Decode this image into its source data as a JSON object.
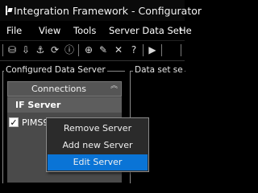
{
  "window": {
    "title": "Integration Framework - Configurator"
  },
  "menu": {
    "items": [
      "File",
      "View",
      "Tools",
      "Server Data Set",
      "He"
    ]
  },
  "toolbar": {
    "icons": [
      "save-icon",
      "import-icon",
      "connect-icon",
      "refresh-icon",
      "info-icon",
      "add-icon",
      "edit-icon",
      "delete-icon",
      "help-icon",
      "run-icon"
    ]
  },
  "left_panel": {
    "title": "Configured Data Server",
    "header": "Connections",
    "group": "IF Server",
    "server": {
      "label": "PIMS904 - Ma",
      "checked": true
    }
  },
  "right_panel": {
    "title": "Data set se"
  },
  "context_menu": {
    "items": [
      "Remove Server",
      "Add new Server",
      "Edit Server"
    ],
    "selected": "Edit Server"
  }
}
